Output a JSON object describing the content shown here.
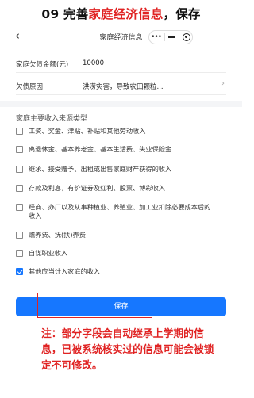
{
  "heading": {
    "prefix": "09 完善",
    "highlight": "家庭经济信息",
    "suffix": "，保存"
  },
  "navbar": {
    "back_icon": "‹",
    "title": "家庭经济信息",
    "menu_icon": "•••"
  },
  "fields": [
    {
      "label": "家庭欠债金额(元)",
      "value": "10000"
    },
    {
      "label": "欠债原因",
      "value": "洪涝灾害，导致农田颗粒..."
    }
  ],
  "section_title": "家庭主要收入来源类型",
  "options": [
    {
      "label": "工资、奖金、津贴、补贴和其他劳动收入",
      "checked": false
    },
    {
      "label": "离退休金、基本养老金、基本生活费、失业保险金",
      "checked": false
    },
    {
      "label": "继承、接受赠予、出租或出售家庭财产获得的收入",
      "checked": false
    },
    {
      "label": "存款及利息，有价证券及红利、股票、博彩收入",
      "checked": false
    },
    {
      "label": "经商、办厂以及从事种植业、养殖业、加工业扣除必要成本后的收入",
      "checked": false
    },
    {
      "label": "赡养费、抚(扶)养费",
      "checked": false
    },
    {
      "label": "自谋职业收入",
      "checked": false
    },
    {
      "label": "其他应当计入家庭的收入",
      "checked": true
    }
  ],
  "save_label": "保存",
  "note": "注：部分字段会自动继承上学期的信息，已被系统核实过的信息可能会被锁定不可修改。",
  "colors": {
    "accent": "#1677ff",
    "highlight_red": "#e02323"
  }
}
